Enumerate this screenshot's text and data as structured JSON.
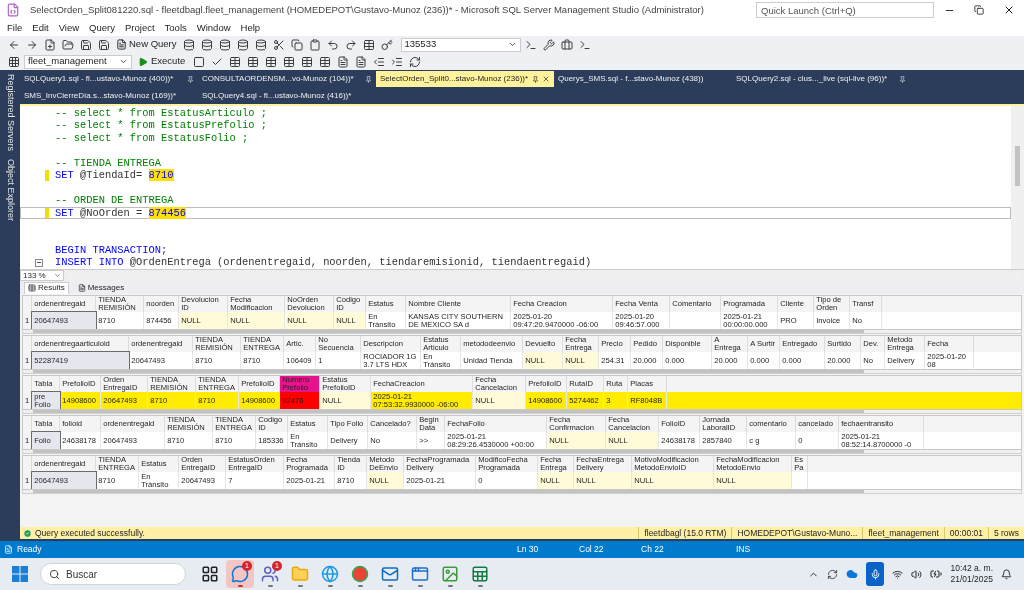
{
  "window": {
    "title": "SelectOrden_Split081220.sql - fleetdbagl.fleet_management (HOMEDEPOT\\Gustavo-Munoz (236))* - Microsoft SQL Server Management Studio (Administrator)",
    "quick_launch_placeholder": "Quick Launch (Ctrl+Q)"
  },
  "menu": [
    "File",
    "Edit",
    "View",
    "Query",
    "Project",
    "Tools",
    "Window",
    "Help"
  ],
  "toolbar": {
    "new_query": "New Query",
    "search_combo": "135533",
    "database_combo": "fleet_management",
    "execute": "Execute"
  },
  "side_panels": [
    "Registered Servers",
    "Object Explorer"
  ],
  "tab_rows": [
    [
      {
        "label": "SQLQuery1.sql - fl...ustavo-Munoz (400))*",
        "selected": false,
        "pinned": true
      },
      {
        "label": "CONSULTAORDENSM...vo-Munoz (104))*",
        "selected": false,
        "pinned": true
      },
      {
        "label": "SelectOrden_Split0...stavo-Munoz (236))*",
        "selected": true,
        "pinned": true
      },
      {
        "label": "Querys_SMS.sql - f...stavo-Munoz (438))",
        "selected": false,
        "pinned": false
      },
      {
        "label": "SQLQuery2.sql - clus..._live (sql-live (96))*",
        "selected": false,
        "pinned": true
      }
    ],
    [
      {
        "label": "SMS_InvCierreDía.s...stavo-Munoz (169))*",
        "selected": false,
        "pinned": false
      },
      {
        "label": "SQLQuery4.sql - fl...ustavo-Munoz (416))*",
        "selected": false,
        "pinned": false
      }
    ]
  ],
  "editor": {
    "lines": [
      {
        "kind": "code",
        "segments": [
          {
            "text": "-- select * from EstatusArticulo ;",
            "kind": "comment"
          }
        ],
        "changed": false,
        "current": false,
        "fold": false
      },
      {
        "kind": "code",
        "segments": [
          {
            "text": "-- select * from EstatusPrefolio ;",
            "kind": "comment"
          }
        ],
        "changed": false,
        "current": false,
        "fold": false
      },
      {
        "kind": "code",
        "segments": [
          {
            "text": "-- select * from EstatusFolio ;",
            "kind": "comment"
          }
        ],
        "changed": false,
        "current": false,
        "fold": false
      },
      {
        "kind": "blank",
        "changed": false,
        "current": false,
        "fold": false
      },
      {
        "kind": "code",
        "segments": [
          {
            "text": "-- TIENDA ENTREGA",
            "kind": "comment"
          }
        ],
        "changed": false,
        "current": false,
        "fold": false
      },
      {
        "kind": "code",
        "segments": [
          {
            "text": "SET",
            "kind": "keyword"
          },
          {
            "text": " @TiendaId= ",
            "kind": "plain"
          },
          {
            "text": "8710",
            "kind": "highlight"
          }
        ],
        "changed": true,
        "current": false,
        "fold": false
      },
      {
        "kind": "blank",
        "changed": false,
        "current": false,
        "fold": false
      },
      {
        "kind": "code",
        "segments": [
          {
            "text": "-- ORDEN DE ENTREGA",
            "kind": "comment"
          }
        ],
        "changed": false,
        "current": false,
        "fold": false
      },
      {
        "kind": "code",
        "segments": [
          {
            "text": "SET",
            "kind": "keyword"
          },
          {
            "text": " @NoOrden = ",
            "kind": "plain"
          },
          {
            "text": "874456",
            "kind": "highlight"
          }
        ],
        "changed": true,
        "current": true,
        "fold": false
      },
      {
        "kind": "blank",
        "changed": false,
        "current": false,
        "fold": false
      },
      {
        "kind": "blank",
        "changed": false,
        "current": false,
        "fold": false
      },
      {
        "kind": "code",
        "segments": [
          {
            "text": "BEGIN TRANSACTION",
            "kind": "keyword"
          },
          {
            "text": ";",
            "kind": "plain"
          }
        ],
        "changed": false,
        "current": false,
        "fold": false
      },
      {
        "kind": "code",
        "segments": [
          {
            "text": "INSERT INTO",
            "kind": "keyword"
          },
          {
            "text": " @OrdenEntrega (ordenentregaid, noorden, tiendaremisionid, tiendaentregaid)",
            "kind": "plain"
          }
        ],
        "changed": false,
        "current": false,
        "fold": true
      }
    ],
    "zoom": "133 %"
  },
  "result_tabs": [
    {
      "label": "Results",
      "selected": true
    },
    {
      "label": "Messages",
      "selected": false
    }
  ],
  "grids": [
    {
      "highlighted": false,
      "columns": [
        {
          "label": "ordenentregaid",
          "marked": false
        },
        {
          "label": "TIENDA REMISIÓN",
          "marked": false
        },
        {
          "label": "noorden",
          "marked": false
        },
        {
          "label": "DevolucionID",
          "marked": false
        },
        {
          "label": "FechaModificacion",
          "marked": false
        },
        {
          "label": "NoOrdenDevolucion",
          "marked": false
        },
        {
          "label": "CodigoID",
          "marked": false
        },
        {
          "label": "Estatus",
          "marked": false
        },
        {
          "label": "Nombre Cliente",
          "marked": false
        },
        {
          "label": "Fecha Creacion",
          "marked": false
        },
        {
          "label": "Fecha Venta",
          "marked": false
        },
        {
          "label": "Comentario",
          "marked": false
        },
        {
          "label": "Programada",
          "marked": false
        },
        {
          "label": "Cliente",
          "marked": false
        },
        {
          "label": "Tipo de Orden",
          "marked": false
        },
        {
          "label": "Transf",
          "marked": false
        }
      ],
      "rows": [
        {
          "number": "1",
          "cells": [
            {
              "text": "20647493",
              "null": false,
              "selected": true,
              "marked": false
            },
            {
              "text": "8710",
              "null": false,
              "selected": false,
              "marked": false
            },
            {
              "text": "874456",
              "null": false,
              "selected": false,
              "marked": false
            },
            {
              "text": "NULL",
              "null": true,
              "selected": false,
              "marked": false
            },
            {
              "text": "NULL",
              "null": true,
              "selected": false,
              "marked": false
            },
            {
              "text": "NULL",
              "null": true,
              "selected": false,
              "marked": false
            },
            {
              "text": "NULL",
              "null": true,
              "selected": false,
              "marked": false
            },
            {
              "text": "En Tránsito",
              "null": false,
              "selected": false,
              "marked": false
            },
            {
              "text": "KANSAS CITY SOUTHERN DE MEXICO SA d",
              "null": false,
              "selected": false,
              "marked": false
            },
            {
              "text": "2025-01-20 09:47:20.9470000 -06:00",
              "null": false,
              "selected": false,
              "marked": false
            },
            {
              "text": "2025-01-20 09:46:57.000",
              "null": false,
              "selected": false,
              "marked": false
            },
            {
              "null": false,
              "selected": false,
              "marked": false
            },
            {
              "text": "2025-01-21 00:00:00.000",
              "null": false,
              "selected": false,
              "marked": false
            },
            {
              "text": "PRO",
              "null": false,
              "selected": false,
              "marked": false
            },
            {
              "text": "Invoice",
              "null": false,
              "selected": false,
              "marked": false
            },
            {
              "text": "No",
              "null": false,
              "selected": false,
              "marked": false
            }
          ]
        }
      ]
    },
    {
      "highlighted": false,
      "columns": [
        {
          "label": "ordenentregaarticuloid",
          "marked": false
        },
        {
          "label": "ordenentregaid",
          "marked": false
        },
        {
          "label": "TIENDA REMISIÓN",
          "marked": false
        },
        {
          "label": "TIENDA ENTREGA",
          "marked": false
        },
        {
          "label": "Artic.",
          "marked": false
        },
        {
          "label": "NoSecuencia",
          "marked": false
        },
        {
          "label": "Descripcion",
          "marked": false
        },
        {
          "label": "Estatus Articulo",
          "marked": false
        },
        {
          "label": "metododeenvio",
          "marked": false
        },
        {
          "label": "Devuelto",
          "marked": false
        },
        {
          "label": "Fecha Entrega",
          "marked": false
        },
        {
          "label": "Precio",
          "marked": false
        },
        {
          "label": "Pedido",
          "marked": false
        },
        {
          "label": "Disponible",
          "marked": false
        },
        {
          "label": "A Entrega",
          "marked": false
        },
        {
          "label": "A Surtir",
          "marked": false
        },
        {
          "label": "Entregado",
          "marked": false
        },
        {
          "label": "Surtido",
          "marked": false
        },
        {
          "label": "Dev.",
          "marked": false
        },
        {
          "label": "MetodoEntrega",
          "marked": false
        },
        {
          "label": "Fecha",
          "marked": false
        }
      ],
      "rows": [
        {
          "number": "1",
          "cells": [
            {
              "text": "52287419",
              "null": false,
              "selected": true,
              "marked": false
            },
            {
              "text": "20647493",
              "null": false,
              "selected": false,
              "marked": false
            },
            {
              "text": "8710",
              "null": false,
              "selected": false,
              "marked": false
            },
            {
              "text": "8710",
              "null": false,
              "selected": false,
              "marked": false
            },
            {
              "text": "106409",
              "null": false,
              "selected": false,
              "marked": false
            },
            {
              "text": "1",
              "null": false,
              "selected": false,
              "marked": false
            },
            {
              "text": "ROCIADOR 1G 3.7 LTS HDX",
              "null": false,
              "selected": false,
              "marked": false
            },
            {
              "text": "En Tránsito",
              "null": false,
              "selected": false,
              "marked": false
            },
            {
              "text": "Unidad Tienda",
              "null": false,
              "selected": false,
              "marked": false
            },
            {
              "text": "NULL",
              "null": true,
              "selected": false,
              "marked": false
            },
            {
              "text": "NULL",
              "null": true,
              "selected": false,
              "marked": false
            },
            {
              "text": "254.31",
              "null": false,
              "selected": false,
              "marked": false
            },
            {
              "text": "20.000",
              "null": false,
              "selected": false,
              "marked": false
            },
            {
              "text": "0.000",
              "null": false,
              "selected": false,
              "marked": false
            },
            {
              "text": "20.000",
              "null": false,
              "selected": false,
              "marked": false
            },
            {
              "text": "0.000",
              "null": false,
              "selected": false,
              "marked": false
            },
            {
              "text": "0.000",
              "null": false,
              "selected": false,
              "marked": false
            },
            {
              "text": "20.000",
              "null": false,
              "selected": false,
              "marked": false
            },
            {
              "text": "No",
              "null": false,
              "selected": false,
              "marked": false
            },
            {
              "text": "Delivery",
              "null": false,
              "selected": false,
              "marked": false
            },
            {
              "text": "2025-01-20 08",
              "null": false,
              "selected": false,
              "marked": false
            }
          ]
        }
      ]
    },
    {
      "highlighted": true,
      "columns": [
        {
          "label": "Tabla",
          "marked": false
        },
        {
          "label": "PrefolioID",
          "marked": false
        },
        {
          "label": "OrdenEntregaID",
          "marked": false
        },
        {
          "label": "TIENDA REMISIÓN",
          "marked": false
        },
        {
          "label": "TIENDA ENTREGA",
          "marked": false
        },
        {
          "label": "PrefolioID",
          "marked": false
        },
        {
          "label": "NumeroPrefolio",
          "marked": true
        },
        {
          "label": "EstatusPrefolioID",
          "marked": false
        },
        {
          "label": "FechaCreacion",
          "marked": false
        },
        {
          "label": "FechaCancelacion",
          "marked": false
        },
        {
          "label": "PrefolioID",
          "marked": false
        },
        {
          "label": "RutaID",
          "marked": false
        },
        {
          "label": "Ruta",
          "marked": false
        },
        {
          "label": "Placas",
          "marked": false
        }
      ],
      "rows": [
        {
          "number": "1",
          "cells": [
            {
              "text": "preFolio",
              "null": false,
              "selected": true,
              "marked": false
            },
            {
              "text": "14908600",
              "null": false,
              "selected": false,
              "marked": false
            },
            {
              "text": "20647493",
              "null": false,
              "selected": false,
              "marked": false
            },
            {
              "text": "8710",
              "null": false,
              "selected": false,
              "marked": false
            },
            {
              "text": "8710",
              "null": false,
              "selected": false,
              "marked": false
            },
            {
              "text": "14908600",
              "null": false,
              "selected": false,
              "marked": false
            },
            {
              "text": "92476",
              "null": false,
              "selected": false,
              "marked": true
            },
            {
              "text": "NULL",
              "null": true,
              "selected": false,
              "marked": false
            },
            {
              "text": "2025-01-21 07:53:32.9930000 -06:00",
              "null": false,
              "selected": false,
              "marked": false
            },
            {
              "text": "NULL",
              "null": true,
              "selected": false,
              "marked": false
            },
            {
              "text": "14908600",
              "null": false,
              "selected": false,
              "marked": false
            },
            {
              "text": "5274462",
              "null": false,
              "selected": false,
              "marked": false
            },
            {
              "text": "3",
              "null": false,
              "selected": false,
              "marked": false
            },
            {
              "text": "RF8048B",
              "null": false,
              "selected": false,
              "marked": false
            }
          ]
        }
      ]
    },
    {
      "highlighted": false,
      "columns": [
        {
          "label": "Tabla",
          "marked": false
        },
        {
          "label": "folioid",
          "marked": false
        },
        {
          "label": "ordenentregaid",
          "marked": false
        },
        {
          "label": "TIENDA REMISIÓN",
          "marked": false
        },
        {
          "label": "TIENDA ENTREGA",
          "marked": false
        },
        {
          "label": "CodigoID",
          "marked": false
        },
        {
          "label": "Estatus",
          "marked": false
        },
        {
          "label": "Tipo Folio",
          "marked": false
        },
        {
          "label": "Cancelado?",
          "marked": false
        },
        {
          "label": "BeginData",
          "marked": false
        },
        {
          "label": "FechaFolio",
          "marked": false
        },
        {
          "label": "FechaConfirmacion",
          "marked": false
        },
        {
          "label": "FechaCancelacion",
          "marked": false
        },
        {
          "label": "FolioID",
          "marked": false
        },
        {
          "label": "JornadaLaboralID",
          "marked": false
        },
        {
          "label": "comentario",
          "marked": false
        },
        {
          "label": "cancelado",
          "marked": false
        },
        {
          "label": "fechaentransito",
          "marked": false
        }
      ],
      "rows": [
        {
          "number": "1",
          "cells": [
            {
              "text": "Folio",
              "null": false,
              "selected": true,
              "marked": false
            },
            {
              "text": "24638178",
              "null": false,
              "selected": false,
              "marked": false
            },
            {
              "text": "20647493",
              "null": false,
              "selected": false,
              "marked": false
            },
            {
              "text": "8710",
              "null": false,
              "selected": false,
              "marked": false
            },
            {
              "text": "8710",
              "null": false,
              "selected": false,
              "marked": false
            },
            {
              "text": "185336",
              "null": false,
              "selected": false,
              "marked": false
            },
            {
              "text": "En Tránsito",
              "null": false,
              "selected": false,
              "marked": false
            },
            {
              "text": "Delivery",
              "null": false,
              "selected": false,
              "marked": false
            },
            {
              "text": "No",
              "null": false,
              "selected": false,
              "marked": false
            },
            {
              "text": ">>",
              "null": false,
              "selected": false,
              "marked": false
            },
            {
              "text": "2025-01-21 08:29:26.4530000 +00:00",
              "null": false,
              "selected": false,
              "marked": false
            },
            {
              "text": "NULL",
              "null": true,
              "selected": false,
              "marked": false
            },
            {
              "text": "NULL",
              "null": true,
              "selected": false,
              "marked": false
            },
            {
              "text": "24638178",
              "null": false,
              "selected": false,
              "marked": false
            },
            {
              "text": "2857840",
              "null": false,
              "selected": false,
              "marked": false
            },
            {
              "text": "c g",
              "null": false,
              "selected": false,
              "marked": false
            },
            {
              "text": "0",
              "null": false,
              "selected": false,
              "marked": false
            },
            {
              "text": "2025-01-21 08:52:14.8700000 -0",
              "null": false,
              "selected": false,
              "marked": false
            }
          ]
        }
      ]
    },
    {
      "highlighted": false,
      "columns": [
        {
          "label": "ordenentregaid",
          "marked": false
        },
        {
          "label": "TIENDA ENTREGA",
          "marked": false
        },
        {
          "label": "Estatus",
          "marked": false
        },
        {
          "label": "OrdenEntregaID",
          "marked": false
        },
        {
          "label": "EstatusOrdenEntregaID",
          "marked": false
        },
        {
          "label": "FechaProgramada",
          "marked": false
        },
        {
          "label": "TiendaID",
          "marked": false
        },
        {
          "label": "MetodoDeEnvio",
          "marked": false
        },
        {
          "label": "FechaProgramadaDelivery",
          "marked": false
        },
        {
          "label": "ModificoFechaProgramada",
          "marked": false
        },
        {
          "label": "FechaEntrega",
          "marked": false
        },
        {
          "label": "FechaEntregaDelivery",
          "marked": false
        },
        {
          "label": "MotivoModificacionMetodoEnvioID",
          "marked": false
        },
        {
          "label": "FechaModificacionMetodoEnvio",
          "marked": false
        },
        {
          "label": "EsPa",
          "marked": false
        }
      ],
      "rows": [
        {
          "number": "1",
          "cells": [
            {
              "text": "20647493",
              "null": false,
              "selected": true,
              "marked": false
            },
            {
              "text": "8710",
              "null": false,
              "selected": false,
              "marked": false
            },
            {
              "text": "En Tránsito",
              "null": false,
              "selected": false,
              "marked": false
            },
            {
              "text": "20647493",
              "null": false,
              "selected": false,
              "marked": false
            },
            {
              "text": "7",
              "null": false,
              "selected": false,
              "marked": false
            },
            {
              "text": "2025-01-21",
              "null": false,
              "selected": false,
              "marked": false
            },
            {
              "text": "8710",
              "null": false,
              "selected": false,
              "marked": false
            },
            {
              "text": "NULL",
              "null": true,
              "selected": false,
              "marked": false
            },
            {
              "text": "2025-01-21",
              "null": false,
              "selected": false,
              "marked": false
            },
            {
              "text": "0",
              "null": false,
              "selected": false,
              "marked": false
            },
            {
              "text": "NULL",
              "null": true,
              "selected": false,
              "marked": false
            },
            {
              "text": "NULL",
              "null": true,
              "selected": false,
              "marked": false
            },
            {
              "text": "NULL",
              "null": true,
              "selected": false,
              "marked": false
            },
            {
              "text": "NULL",
              "null": true,
              "selected": false,
              "marked": false
            },
            {
              "null": false,
              "selected": false,
              "marked": false
            }
          ]
        }
      ]
    }
  ],
  "query_status": {
    "message": "Query executed successfully.",
    "server": "fleetdbagl (15.0 RTM)",
    "user": "HOMEDEPOT\\Gustavo-Muno...",
    "database": "fleet_management",
    "elapsed": "00:00:01",
    "rows": "5 rows"
  },
  "status_bar": {
    "state": "Ready",
    "line": "Ln 30",
    "col": "Col 22",
    "ch": "Ch 22",
    "mode": "INS"
  },
  "taskbar": {
    "search_placeholder": "Buscar",
    "apps": [
      {
        "kind": "task-view",
        "active": false,
        "running": false
      },
      {
        "kind": "chat",
        "active": true,
        "running": true,
        "badge": "1"
      },
      {
        "kind": "people",
        "active": false,
        "running": true,
        "badge": "1"
      },
      {
        "kind": "folder",
        "active": false,
        "running": true
      },
      {
        "kind": "browser-wave",
        "active": false,
        "running": true
      },
      {
        "kind": "browser-ring",
        "active": false,
        "running": true
      },
      {
        "kind": "mail",
        "active": false,
        "running": true
      },
      {
        "kind": "window",
        "active": false,
        "running": true
      },
      {
        "kind": "image",
        "active": false,
        "running": true
      },
      {
        "kind": "sheet",
        "active": false,
        "running": true
      }
    ],
    "time": "10:42 a. m.",
    "date": "21/01/2025"
  }
}
